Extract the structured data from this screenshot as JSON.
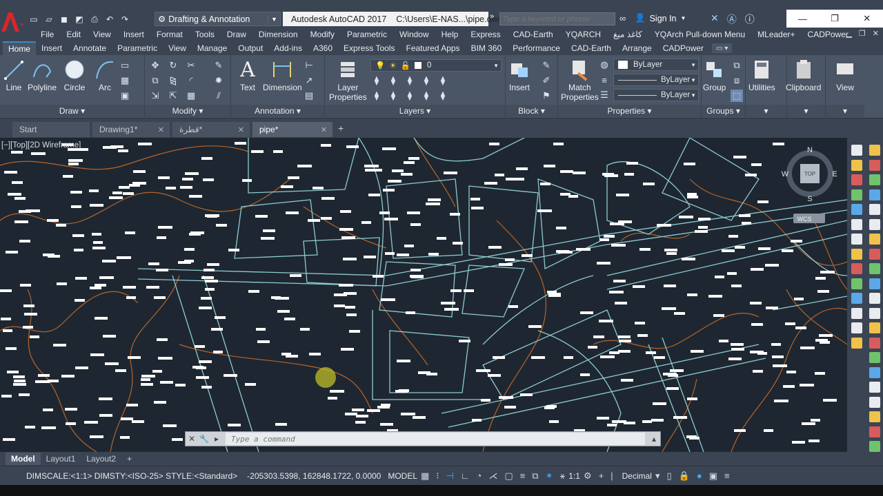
{
  "titlebar": {
    "app_name": "Autodesk AutoCAD 2017",
    "file_path": "C:\\Users\\E-NAS...\\pipe.dwg",
    "workspace": "Drafting & Annotation",
    "search_placeholder": "Type a keyword or phrase",
    "sign_in": "Sign In"
  },
  "menu": [
    "File",
    "Edit",
    "View",
    "Insert",
    "Format",
    "Tools",
    "Draw",
    "Dimension",
    "Modify",
    "Parametric",
    "Window",
    "Help",
    "Express",
    "CAD-Earth",
    "YQARCH",
    "كاغذ ميغ",
    "YQArch Pull-down Menu",
    "MLeader+",
    "CADPower"
  ],
  "ribbon_tabs": [
    "Home",
    "Insert",
    "Annotate",
    "Parametric",
    "View",
    "Manage",
    "Output",
    "Add-ins",
    "A360",
    "Express Tools",
    "Featured Apps",
    "BIM 360",
    "Performance",
    "CAD-Earth",
    "Arrange",
    "CADPower"
  ],
  "ribbon": {
    "draw": {
      "title": "Draw",
      "line": "Line",
      "polyline": "Polyline",
      "circle": "Circle",
      "arc": "Arc"
    },
    "modify": {
      "title": "Modify"
    },
    "annotation": {
      "title": "Annotation",
      "text": "Text",
      "dimension": "Dimension"
    },
    "layers": {
      "title": "Layers",
      "layer_properties_1": "Layer",
      "layer_properties_2": "Properties",
      "current_layer": "0"
    },
    "block": {
      "title": "Block",
      "insert": "Insert"
    },
    "properties": {
      "title": "Properties",
      "match_1": "Match",
      "match_2": "Properties",
      "color": "ByLayer",
      "linetype": "ByLayer",
      "lineweight": "ByLayer"
    },
    "groups": {
      "title": "Groups",
      "group": "Group"
    },
    "utilities": "Utilities",
    "clipboard": "Clipboard",
    "view": "View"
  },
  "file_tabs": [
    {
      "label": "Start"
    },
    {
      "label": "Drawing1*"
    },
    {
      "label": "قطرة*"
    },
    {
      "label": "pipe*"
    }
  ],
  "viewport": {
    "label": "[−][Top][2D Wireframe]",
    "compass": {
      "n": "N",
      "s": "S",
      "e": "E",
      "w": "W",
      "top": "TOP",
      "wcs": "WCS"
    }
  },
  "command_line": {
    "placeholder": "Type a command"
  },
  "layout_tabs": [
    "Model",
    "Layout1",
    "Layout2"
  ],
  "status": {
    "dim_info": "DIMSCALE:<1:1> DIMSTY:<ISO-25> STYLE:<Standard>",
    "coordinates": "-205303.5398, 162848.1722, 0.0000",
    "space": "MODEL",
    "scale": "1:1",
    "units": "Decimal"
  },
  "colors": {
    "background": "#1e2731",
    "parcel_lines": "#8ecbd0",
    "contours": "#b8642a",
    "labels": "#ffffff",
    "ribbon": "#4a5566"
  }
}
